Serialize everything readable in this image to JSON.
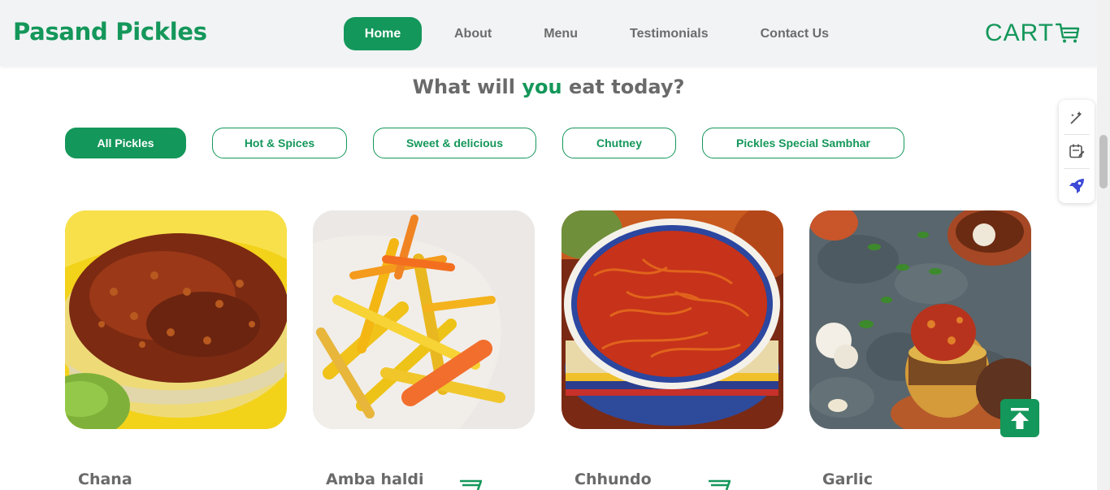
{
  "header": {
    "brand": "Pasand Pickles",
    "nav": [
      {
        "label": "Home",
        "active": true
      },
      {
        "label": "About"
      },
      {
        "label": "Menu"
      },
      {
        "label": "Testimonials"
      },
      {
        "label": "Contact Us"
      }
    ],
    "cart_label": "CART",
    "cart_icon": "shopping-cart-icon"
  },
  "section": {
    "heading_pre": "What will ",
    "heading_highlight": "you",
    "heading_post": " eat today?"
  },
  "filters": [
    {
      "label": "All Pickles",
      "active": true
    },
    {
      "label": "Hot & Spices"
    },
    {
      "label": "Sweet & delicious"
    },
    {
      "label": "Chutney"
    },
    {
      "label": "Pickles Special Sambhar"
    }
  ],
  "products": [
    {
      "name": "Chana",
      "image": "chana-pickle-photo",
      "has_cart_icon": false
    },
    {
      "name": "Amba haldi",
      "image": "amba-haldi-pickle-photo",
      "has_cart_icon": true
    },
    {
      "name": "Chhundo",
      "image": "chhundo-pickle-photo",
      "has_cart_icon": true
    },
    {
      "name": "Garlic",
      "image": "garlic-pickle-photo",
      "has_cart_icon": false
    }
  ],
  "controls": {
    "scroll_top_icon": "arrow-up-to-top-icon",
    "side_tools": [
      "magic-wand-icon",
      "calendar-edit-icon",
      "rocket-icon"
    ]
  },
  "colors": {
    "brand_green": "#14975a",
    "text_grey": "#6a6a6a",
    "header_bg": "#f1f3f5"
  }
}
